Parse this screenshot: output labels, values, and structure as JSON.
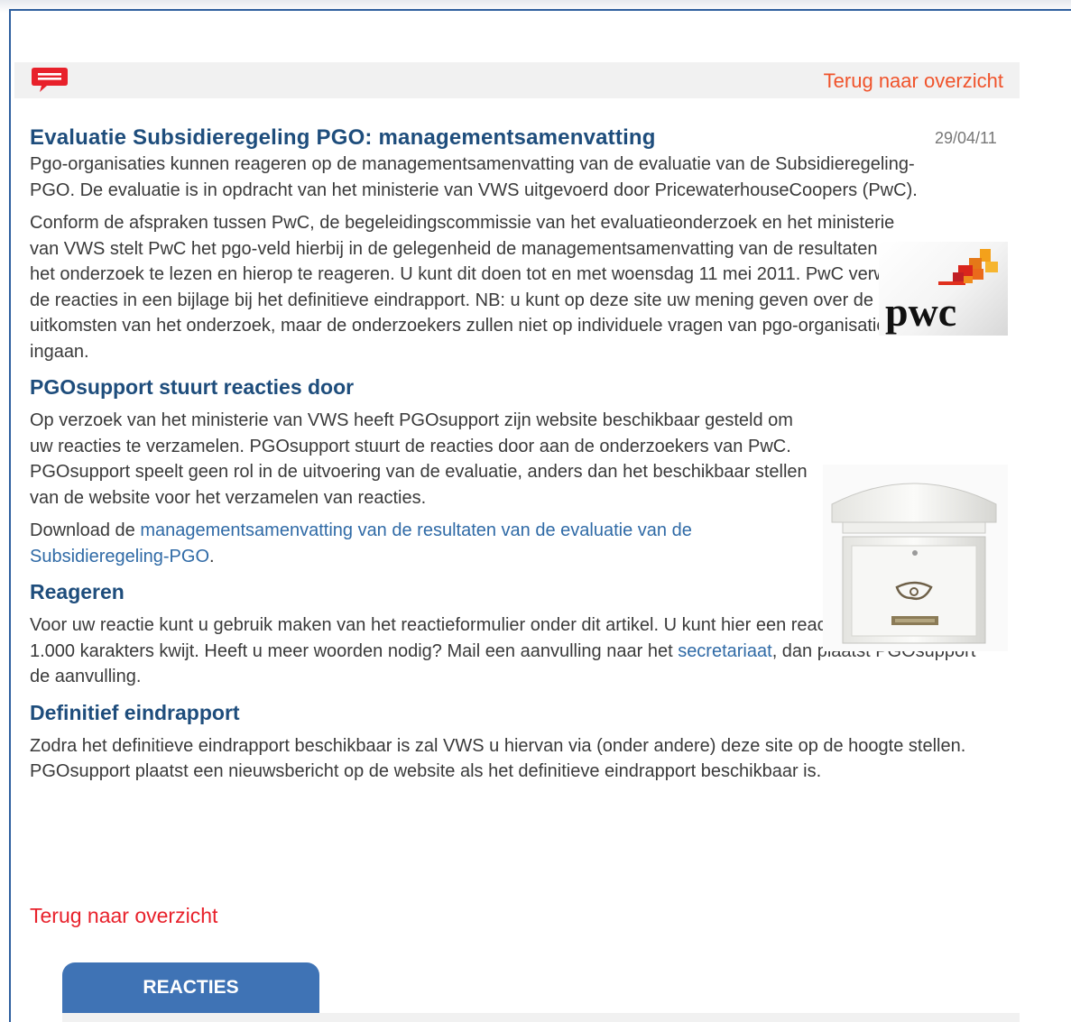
{
  "header": {
    "back_link": "Terug naar overzicht"
  },
  "article": {
    "title": "Evaluatie Subsidieregeling PGO: managementsamenvatting",
    "date": "29/04/11",
    "intro": "Pgo-organisaties kunnen reageren op de managementsamenvatting van de evaluatie van de Subsidieregeling-PGO. De evaluatie is in opdracht van het ministerie van VWS uitgevoerd door PricewaterhouseCoopers (PwC).",
    "para2": "Conform de afspraken tussen PwC, de begeleidingscommissie van het evaluatieonderzoek en het ministerie van VWS stelt PwC het pgo-veld hierbij in de gelegenheid de managementsamenvatting van de resultaten van het onderzoek te lezen en hierop te reageren. U kunt dit doen tot en met woensdag 11 mei 2011. PwC verwerkt de reacties in een bijlage bij het definitieve eindrapport. NB: u kunt op deze site uw mening geven over de uitkomsten van het onderzoek, maar de onderzoekers zullen niet op individuele vragen van pgo-organisaties ingaan.",
    "logo_text": "pwc",
    "sections": {
      "support": {
        "heading": "PGOsupport stuurt reacties door",
        "body": "Op verzoek van het ministerie van VWS heeft PGOsupport zijn website beschikbaar gesteld om uw reacties te verzamelen. PGOsupport stuurt de reacties door aan de onderzoekers van PwC. PGOsupport speelt geen rol in de uitvoering van de evaluatie, anders dan het beschikbaar stellen van de website voor het verzamelen van reacties.",
        "download_prefix": "Download de ",
        "download_link": "managementsamenvatting van de resultaten van de evaluatie van de Subsidieregeling-PGO",
        "download_suffix": "."
      },
      "reageren": {
        "heading": "Reageren",
        "body_before": "Voor uw reactie kunt u gebruik maken van het reactieformulier onder dit artikel. U kunt hier een reactie van maximaal 1.000 karakters kwijt. Heeft u meer woorden nodig? Mail een aanvulling naar het ",
        "link": "secretariaat",
        "body_after": ", dan plaatst PGOsupport de aanvulling."
      },
      "eindrapport": {
        "heading": "Definitief eindrapport",
        "body": "Zodra het definitieve eindrapport beschikbaar is zal VWS u hiervan via (onder andere) deze site op de hoogte stellen. PGOsupport plaatst een nieuwsbericht op de website als het definitieve eindrapport beschikbaar is."
      }
    },
    "back_link": "Terug naar overzicht"
  },
  "reacties_tab": "REACTIES",
  "colors": {
    "title_blue": "#1e4d7c",
    "link_orange": "#f0532b",
    "link_red": "#e8212b",
    "link_blue": "#2f6aa6",
    "tab_blue": "#3f73b5",
    "icon_red": "#e8212b"
  },
  "icons": {
    "chat": "chat-bubble-icon"
  }
}
